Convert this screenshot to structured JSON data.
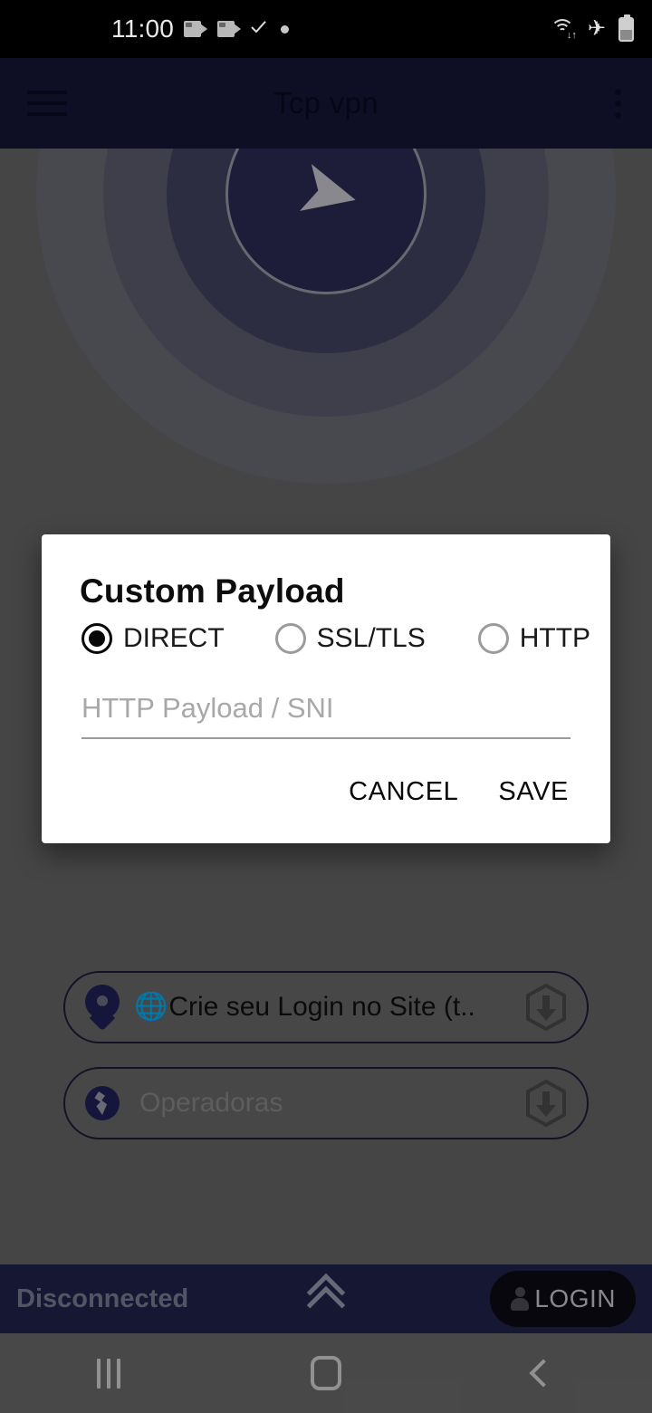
{
  "status_bar": {
    "time": "11:00",
    "left_icons": [
      "camera-icon",
      "camera-icon",
      "check-icon",
      "dot-icon"
    ],
    "right_icons": [
      "wifi-icon",
      "airplane-mode-icon",
      "battery-icon"
    ],
    "background_color": "#000000"
  },
  "app_bar": {
    "title": "Tcp vpn",
    "menu_icon": "hamburger-menu-icon",
    "overflow_icon": "more-vertical-icon",
    "background_color": "#161737"
  },
  "main": {
    "rings_icon": "vpn-connect-rings",
    "center_icon": "paper-plane-icon",
    "pills": [
      {
        "location_icon": "map-pin-icon",
        "prefix_icon": "globe-icon",
        "label": "Crie seu Login no Site (t..",
        "trailing_icon": "hexagon-download-icon",
        "muted": false
      },
      {
        "location_icon": "globe-small-icon",
        "prefix_icon": "",
        "label": "Operadoras",
        "trailing_icon": "hexagon-download-icon",
        "muted": true
      }
    ]
  },
  "dialog": {
    "title": "Custom Payload",
    "radio_options": [
      {
        "label": "DIRECT",
        "selected": true
      },
      {
        "label": "SSL/TLS",
        "selected": false
      },
      {
        "label": "HTTP",
        "selected": false
      }
    ],
    "input": {
      "value": "",
      "placeholder": "HTTP Payload / SNI"
    },
    "cancel_label": "CANCEL",
    "save_label": "SAVE",
    "background_color": "#ffffff"
  },
  "bottom_bar": {
    "status": "Disconnected",
    "expand_icon": "double-chevron-up-icon",
    "login_icon": "person-icon",
    "login_label": "LOGIN",
    "background_color": "#21224a"
  },
  "nav_bar": {
    "recents_icon": "recents-icon",
    "home_icon": "home-icon",
    "back_icon": "back-icon",
    "background_color": "#6b6b6b"
  }
}
